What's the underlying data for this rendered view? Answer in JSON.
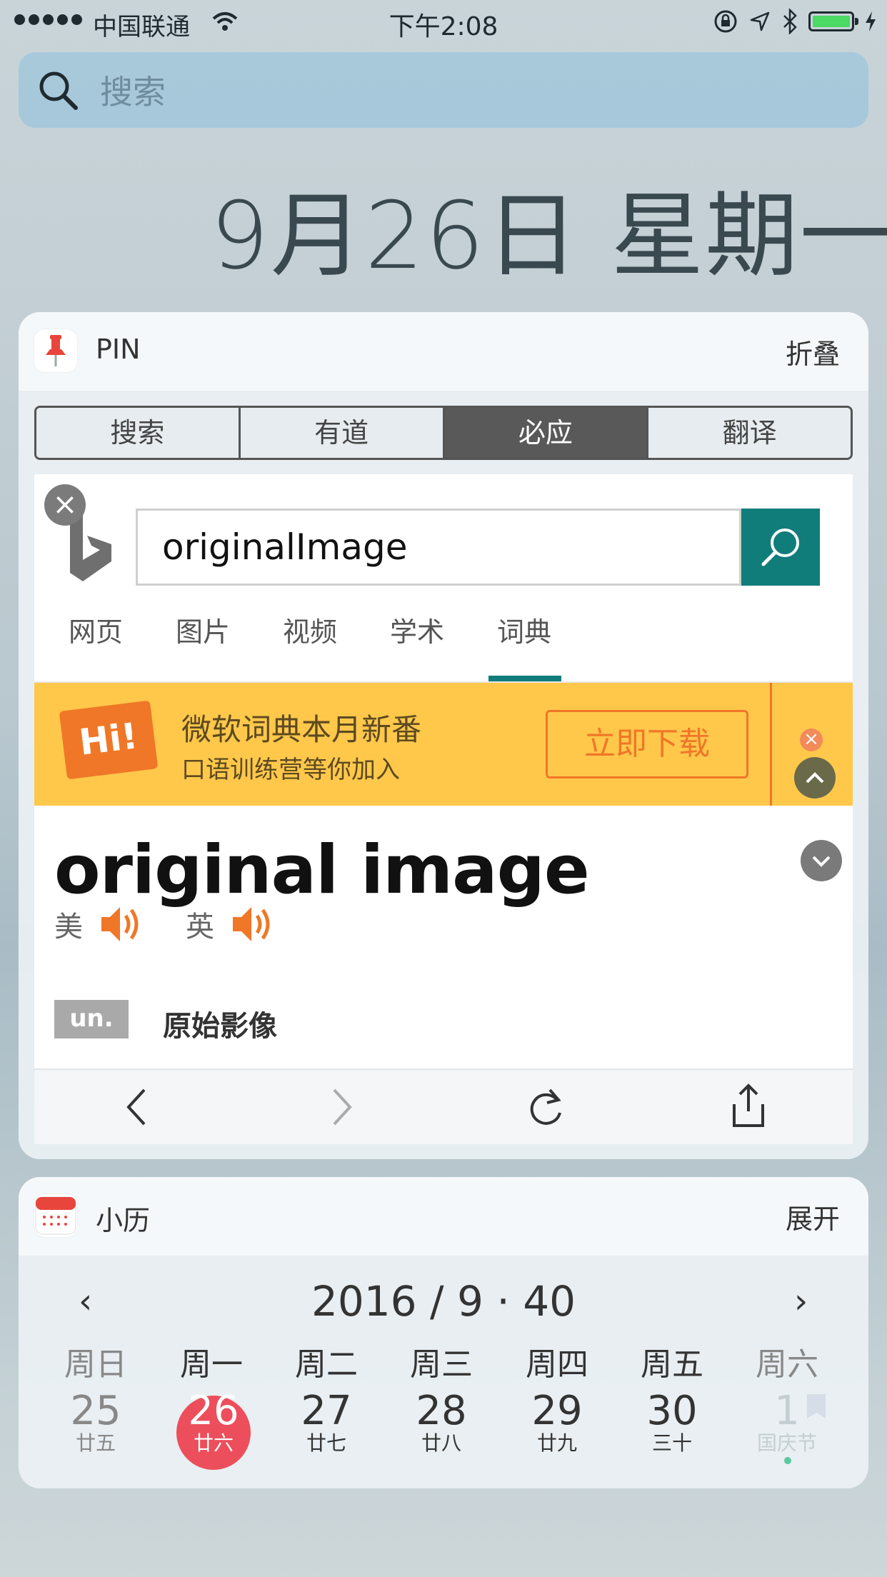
{
  "status_bar": {
    "carrier": "中国联通",
    "time": "下午2:08",
    "battery_color": "#4cd964"
  },
  "search": {
    "placeholder": "搜索"
  },
  "date_title": "9月26日 星期一",
  "pin_widget": {
    "app_name": "PIN",
    "action": "折叠",
    "segments": [
      {
        "label": "搜索",
        "active": false
      },
      {
        "label": "有道",
        "active": false
      },
      {
        "label": "必应",
        "active": true
      },
      {
        "label": "翻译",
        "active": false
      }
    ],
    "bing": {
      "query": "originalImage",
      "tabs": [
        "网页",
        "图片",
        "视频",
        "学术",
        "词典"
      ],
      "active_tab": "词典",
      "accent": "#117d7b",
      "promo": {
        "badge": "Hi!",
        "line1": "微软词典本月新番",
        "line2": "口语训练营等你加入",
        "button": "立即下载"
      },
      "dictionary": {
        "word": "original image",
        "pron_us": "美",
        "pron_uk": "英",
        "pos": "un.",
        "definition": "原始影像"
      }
    },
    "toolbar_icons": [
      "back-icon",
      "forward-icon",
      "reload-icon",
      "share-icon"
    ]
  },
  "calendar_widget": {
    "app_name": "小历",
    "action": "展开",
    "month_title": "2016 / 9 · 40",
    "prev": "‹",
    "next": "›",
    "weekdays": [
      "周日",
      "周一",
      "周二",
      "周三",
      "周四",
      "周五",
      "周六"
    ],
    "days": [
      {
        "num": "25",
        "lunar": "廿五"
      },
      {
        "num": "26",
        "lunar": "廿六",
        "today": true
      },
      {
        "num": "27",
        "lunar": "廿七"
      },
      {
        "num": "28",
        "lunar": "廿八"
      },
      {
        "num": "29",
        "lunar": "廿九"
      },
      {
        "num": "30",
        "lunar": "三十"
      },
      {
        "num": "1",
        "lunar": "国庆节"
      }
    ],
    "today_color": "#ec4e5b"
  }
}
